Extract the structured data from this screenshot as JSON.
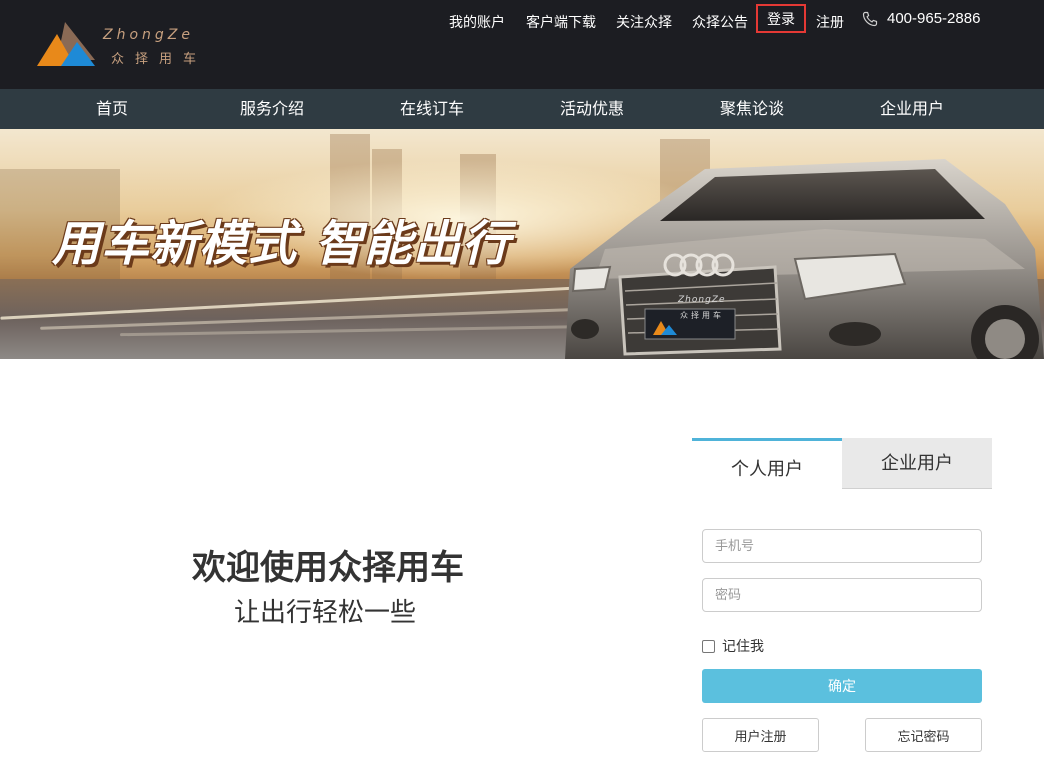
{
  "brand": {
    "name_en": "ZhongZe",
    "name_cn": "众择用车",
    "colors": {
      "gold": "#c7a07f",
      "orange": "#e8891a",
      "blue": "#1e8ad6"
    }
  },
  "header": {
    "links": {
      "account": "我的账户",
      "download": "客户端下载",
      "follow": "关注众择",
      "notice": "众择公告",
      "login": "登录",
      "register": "注册"
    },
    "phone": "400-965-2886",
    "phone_icon": "phone-icon"
  },
  "nav": {
    "items": [
      "首页",
      "服务介绍",
      "在线订车",
      "活动优惠",
      "聚焦论谈",
      "企业用户"
    ]
  },
  "banner": {
    "slogan": "用车新模式  智能出行",
    "plate_en": "ZhongZe",
    "plate_cn": "众择用车"
  },
  "welcome": {
    "title": "欢迎使用众择用车",
    "subtitle": "让出行轻松一些"
  },
  "login": {
    "tabs": {
      "personal": "个人用户",
      "enterprise": "企业用户"
    },
    "active_tab": "personal",
    "phone_placeholder": "手机号",
    "password_placeholder": "密码",
    "remember_label": "记住我",
    "remember_checked": false,
    "submit_label": "确定",
    "register_label": "用户注册",
    "forgot_label": "忘记密码"
  }
}
